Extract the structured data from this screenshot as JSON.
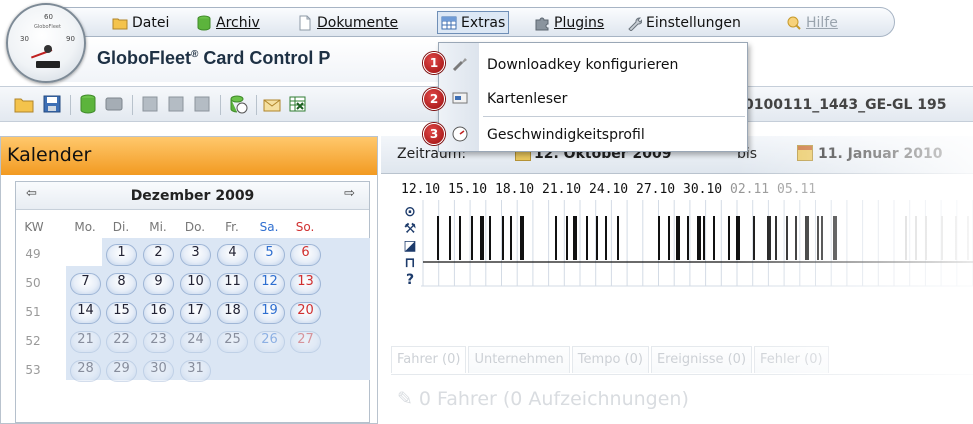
{
  "menubar": {
    "items": [
      {
        "label": "Datei",
        "underline": false,
        "state": "normal",
        "icon": "folder-icon"
      },
      {
        "label": "Archiv",
        "underline": true,
        "state": "normal",
        "icon": "database-icon"
      },
      {
        "label": "Dokumente",
        "underline": true,
        "state": "normal",
        "icon": "document-icon"
      },
      {
        "label": "Extras",
        "underline": false,
        "state": "active",
        "icon": "grid-icon"
      },
      {
        "label": "Plugins",
        "underline": true,
        "state": "normal",
        "icon": "puzzle-icon"
      },
      {
        "label": "Einstellungen",
        "underline": false,
        "state": "normal",
        "icon": "wrench-icon"
      },
      {
        "label": "Hilfe",
        "underline": true,
        "state": "disabled",
        "icon": "help-icon"
      }
    ]
  },
  "app": {
    "title": "GloboFleet",
    "title_reg": "®",
    "title_rest": " Card Control P",
    "dial_brand": "GloboFleet",
    "dial_ticks": [
      "60",
      "30",
      "90"
    ]
  },
  "toolbar": {
    "file_path": "0100111_1443_GE-GL 195"
  },
  "dropdown": {
    "items": [
      {
        "label": "Downloadkey konfigurieren",
        "badge": "1",
        "icon": "key-icon"
      },
      {
        "label": "Kartenleser",
        "badge": "2",
        "icon": "card-reader-icon"
      },
      {
        "label": "Geschwindigkeitsprofil",
        "badge": "3",
        "icon": "speedometer-icon"
      }
    ]
  },
  "calendar": {
    "header": "Kalender",
    "month": "Dezember 2009",
    "prev": "⇦",
    "next": "⇨",
    "kw_label": "KW",
    "weekdays": [
      "Mo.",
      "Di.",
      "Mi.",
      "Do.",
      "Fr.",
      "Sa.",
      "So."
    ],
    "weeks": [
      {
        "kw": "49",
        "days": [
          "",
          "1",
          "2",
          "3",
          "4",
          "5",
          "6"
        ]
      },
      {
        "kw": "50",
        "days": [
          "7",
          "8",
          "9",
          "10",
          "11",
          "12",
          "13"
        ]
      },
      {
        "kw": "51",
        "days": [
          "14",
          "15",
          "16",
          "17",
          "18",
          "19",
          "20"
        ]
      },
      {
        "kw": "52",
        "days": [
          "21",
          "22",
          "23",
          "24",
          "25",
          "26",
          "27"
        ]
      },
      {
        "kw": "53",
        "days": [
          "28",
          "29",
          "30",
          "31",
          "",
          "",
          ""
        ]
      }
    ]
  },
  "range": {
    "label": "Zeitraum:",
    "start": "12. Oktober 2009",
    "bis": "bis",
    "end": "11. Januar 2010"
  },
  "activity": {
    "dates": [
      "12.10",
      "15.10",
      "18.10",
      "21.10",
      "24.10",
      "27.10",
      "30.10",
      "02.11",
      "05.11"
    ],
    "row_icons": [
      "⊙",
      "⚒",
      "◪",
      "⊓",
      "?"
    ],
    "row_icon_names": [
      "driving-icon",
      "work-icon",
      "availability-icon",
      "rest-icon",
      "unknown-icon"
    ]
  },
  "tabs": [
    "Fahrer (0)",
    "Unternehmen",
    "Tempo (0)",
    "Ereignisse (0)",
    "Fehler (0)"
  ],
  "fahrer_count": "0 Fahrer (0 Aufzeichnungen)"
}
